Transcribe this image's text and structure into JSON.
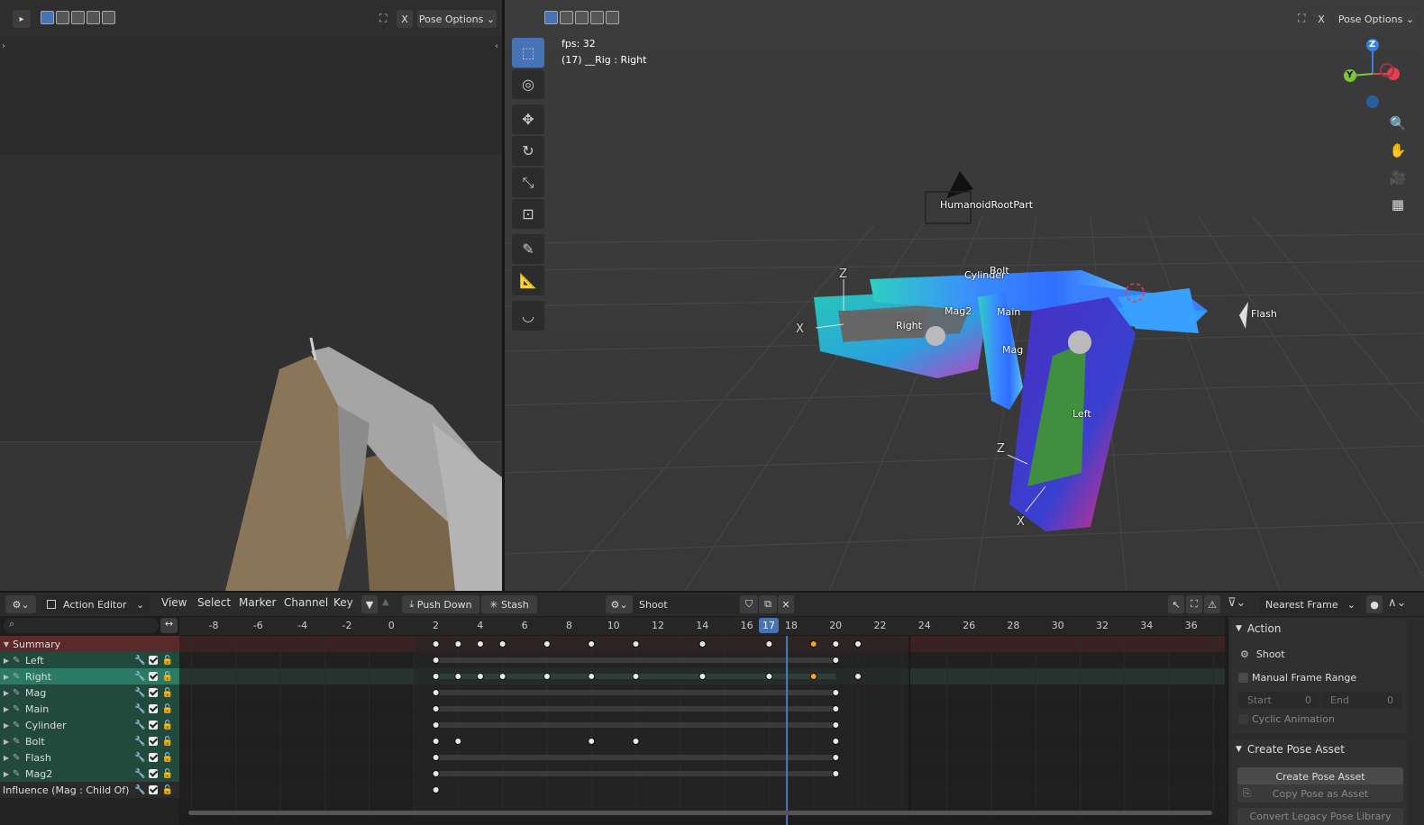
{
  "left_view": {
    "pose_options": "Pose Options"
  },
  "right_view": {
    "pose_options": "Pose Options",
    "fps": "fps: 32",
    "frame_info": "(17) __Rig : Right",
    "labels": {
      "root": "HumanoidRootPart",
      "cylinder": "Cylinder",
      "bolt": "Bolt",
      "mag2": "Mag2",
      "main": "Main",
      "mag": "Mag",
      "right": "Right",
      "left": "Left",
      "flash": "Flash",
      "z1": "Z",
      "x1": "X",
      "z2": "Z",
      "x2": "X"
    },
    "gizmo": {
      "z": "Z",
      "y": "Y"
    }
  },
  "timeline": {
    "editor_mode": "Action Editor",
    "menus": [
      "View",
      "Select",
      "Marker",
      "Channel",
      "Key"
    ],
    "push_down": "Push Down",
    "stash": "Stash",
    "action_name": "Shoot",
    "snap_mode": "Nearest Frame",
    "current_frame": "17",
    "ticks": [
      "-8",
      "-6",
      "-4",
      "-2",
      "0",
      "2",
      "4",
      "6",
      "8",
      "10",
      "12",
      "14",
      "16",
      "18",
      "20",
      "22",
      "24",
      "26",
      "28",
      "30",
      "32",
      "34",
      "36"
    ],
    "channels": {
      "summary": "Summary",
      "left": "Left",
      "right": "Right",
      "mag": "Mag",
      "main": "Main",
      "cylinder": "Cylinder",
      "bolt": "Bolt",
      "flash": "Flash",
      "mag2": "Mag2",
      "influence": "Influence (Mag : Child Of)"
    }
  },
  "side_panel": {
    "action_header": "Action",
    "action_name": "Shoot",
    "manual_frame_range": "Manual Frame Range",
    "start_label": "Start",
    "start_value": "0",
    "end_label": "End",
    "end_value": "0",
    "cyclic": "Cyclic Animation",
    "create_pose_header": "Create Pose Asset",
    "create_pose_btn": "Create Pose Asset",
    "copy_pose_btn": "Copy Pose as Asset",
    "convert_btn": "Convert Legacy Pose Library"
  }
}
